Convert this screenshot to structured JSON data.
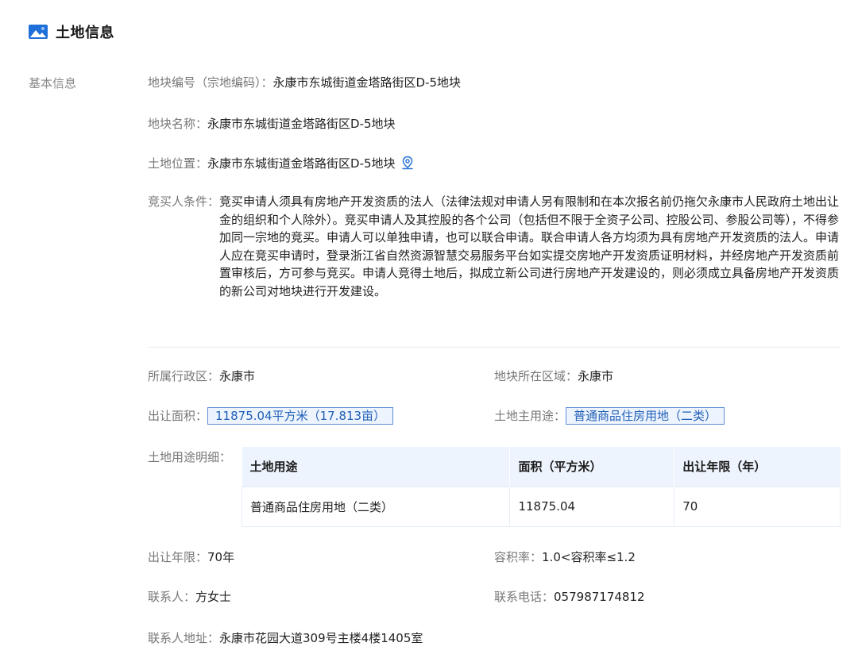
{
  "header": {
    "title": "土地信息",
    "icon": "landscape-image-icon",
    "accent_color": "#1e6fd9"
  },
  "section": {
    "label": "基本信息"
  },
  "fields": {
    "parcel_code": {
      "label": "地块编号（宗地编码）：",
      "value": "永康市东城街道金塔路街区D-5地块"
    },
    "parcel_name": {
      "label": "地块名称：",
      "value": "永康市东城街道金塔路街区D-5地块"
    },
    "land_location": {
      "label": "土地位置：",
      "value": "永康市东城街道金塔路街区D-5地块",
      "icon": "location-pin-icon"
    },
    "bidder_conditions": {
      "label": "竞买人条件：",
      "value": "竞买申请人须具有房地产开发资质的法人（法律法规对申请人另有限制和在本次报名前仍拖欠永康市人民政府土地出让金的组织和个人除外）。竞买申请人及其控股的各个公司（包括但不限于全资子公司、控股公司、参股公司等），不得参加同一宗地的竞买。申请人可以单独申请，也可以联合申请。联合申请人各方均须为具有房地产开发资质的法人。申请人应在竞买申请时，登录浙江省自然资源智慧交易服务平台如实提交房地产开发资质证明材料，并经房地产开发资质前置审核后，方可参与竞买。申请人竞得土地后，拟成立新公司进行房地产开发建设的，则必须成立具备房地产开发资质的新公司对地块进行开发建设。"
    },
    "admin_district": {
      "label": "所属行政区：",
      "value": "永康市"
    },
    "parcel_region": {
      "label": "地块所在区域：",
      "value": "永康市"
    },
    "transfer_area": {
      "label": "出让面积：",
      "value": "11875.04平方米（17.813亩）"
    },
    "main_use": {
      "label": "土地主用途：",
      "value": "普通商品住房用地（二类）"
    },
    "use_detail_label": "土地用途明细：",
    "transfer_term": {
      "label": "出让年限：",
      "value": "70年"
    },
    "plot_ratio": {
      "label": "容积率：",
      "value": "1.0<容积率≤1.2"
    },
    "contact_person": {
      "label": "联系人：",
      "value": "方女士"
    },
    "contact_phone": {
      "label": "联系电话：",
      "value": "057987174812"
    },
    "contact_address": {
      "label": "联系人地址：",
      "value": "永康市花园大道309号主楼4楼1405室"
    }
  },
  "use_table": {
    "headers": [
      "土地用途",
      "面积（平方米）",
      "出让年限（年）"
    ],
    "rows": [
      [
        "普通商品住房用地（二类）",
        "11875.04",
        "70"
      ]
    ]
  },
  "colors": {
    "tag_border": "#5b8fd6",
    "tag_background": "#eef4fd",
    "tag_text": "#1f5fb8",
    "table_header_bg": "#eef4fd"
  }
}
